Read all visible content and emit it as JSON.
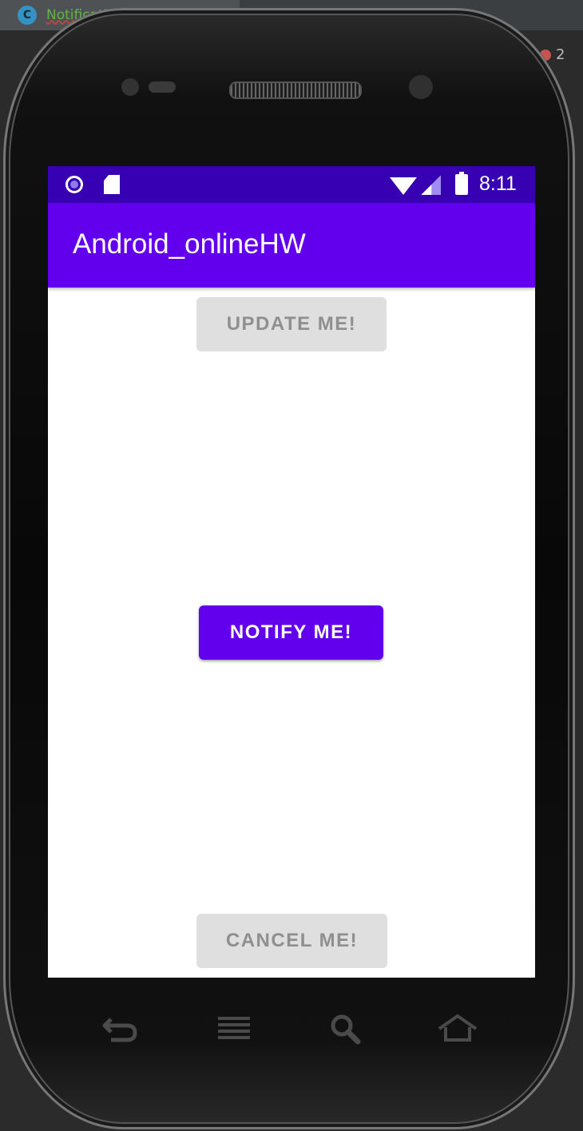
{
  "ide": {
    "tab_label": "NotificationsMainA",
    "tab_icon_letter": "C",
    "error_count": "2"
  },
  "status_bar": {
    "time": "8:11"
  },
  "app_bar": {
    "title": "Android_onlineHW"
  },
  "buttons": {
    "update_label": "UPDATE ME!",
    "notify_label": "NOTIFY ME!",
    "cancel_label": "CANCEL ME!"
  },
  "colors": {
    "primary": "#6200ee",
    "primary_dark": "#3700b3",
    "disabled_bg": "#dfdfdf",
    "disabled_text": "#8f8f8f"
  },
  "nav_icons": [
    "back-icon",
    "menu-icon",
    "search-icon",
    "home-icon"
  ]
}
